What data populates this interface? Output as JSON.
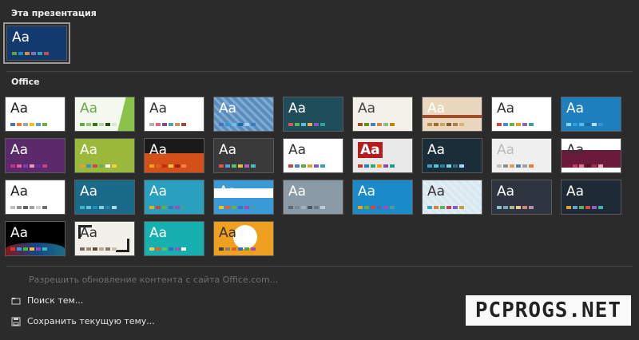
{
  "sections": {
    "this_presentation": "Эта презентация",
    "office": "Office"
  },
  "menu": {
    "allow_update": "Разрешить обновление контента с сайта Office.com...",
    "browse": "Поиск тем...",
    "save": "Сохранить текущую тему..."
  },
  "watermark": "PCPROGS.NET",
  "current_theme": {
    "bg": "#123a6e",
    "text": "#ffffff",
    "label": "Aa",
    "swatches": [
      "#6a9a3a",
      "#1e88c8",
      "#e08a2a",
      "#8c6cc0",
      "#39a0b0",
      "#c05050"
    ]
  },
  "themes": [
    {
      "bg": "#ffffff",
      "text": "#222222",
      "label": "Aa",
      "swatches": [
        "#4472c4",
        "#ed7d31",
        "#a5a5a5",
        "#ffc000",
        "#5b9bd5",
        "#70ad47"
      ]
    },
    {
      "bg": "#f4f9ee",
      "text": "#6aa84f",
      "label": "Aa",
      "swatches": [
        "#6aa84f",
        "#93c47d",
        "#38761d",
        "#b6d7a8",
        "#274e13",
        "#d9ead3"
      ],
      "accent": "#8bc34a"
    },
    {
      "bg": "#ffffff",
      "text": "#333333",
      "label": "Aa",
      "swatches": [
        "#b5b5b5",
        "#d96c75",
        "#7a4e8c",
        "#4fa3b8",
        "#c29b4a",
        "#9b4a4a"
      ]
    },
    {
      "bg": "#5a8dbf",
      "text": "#ffffff",
      "label": "Aa",
      "swatches": [
        "#4472c4",
        "#2f9bd6",
        "#6fc0e0",
        "#1f6aa5",
        "#9ad0ec",
        "#3a7bbf"
      ],
      "pattern": true
    },
    {
      "bg": "#1f4e5a",
      "text": "#ffffff",
      "label": "Aa",
      "swatches": [
        "#d9534f",
        "#5cb85c",
        "#5bc0de",
        "#f0ad4e",
        "#7e57c2",
        "#26a69a"
      ]
    },
    {
      "bg": "#f3f1ea",
      "text": "#444444",
      "label": "Aa",
      "swatches": [
        "#a0522d",
        "#6b8e23",
        "#4682b4",
        "#cd853f",
        "#8fbc8f",
        "#b8860b"
      ]
    },
    {
      "bg": "#e9d8bf",
      "text": "#ffffff",
      "label": "Aa",
      "swatches": [
        "#c48a3a",
        "#9e6b2a",
        "#d4a35a",
        "#8a5a2a",
        "#b07d40",
        "#e0b070"
      ],
      "bar": "#a24c2a"
    },
    {
      "bg": "#ffffff",
      "text": "#333333",
      "label": "Aa",
      "swatches": [
        "#c84a4a",
        "#4a8ac8",
        "#6ab04c",
        "#e0a030",
        "#9060c0",
        "#40a0a0"
      ]
    },
    {
      "bg": "#1e7fbf",
      "text": "#ffffff",
      "label": "Aa",
      "swatches": [
        "#8fd0f0",
        "#2a9fd8",
        "#5ab8e8",
        "#1a6aa0",
        "#b0e0f8",
        "#3a90c8"
      ]
    },
    {
      "bg": "#5a2a6a",
      "text": "#ffffff",
      "label": "Aa",
      "swatches": [
        "#c03090",
        "#e060a0",
        "#8040b0",
        "#f090c0",
        "#6030a0",
        "#d04080"
      ]
    },
    {
      "bg": "#9ab83a",
      "text": "#ffffff",
      "label": "Aa",
      "swatches": [
        "#e8a030",
        "#4a8ac8",
        "#c84a4a",
        "#6ab04c",
        "#ffffff",
        "#f0d040"
      ]
    },
    {
      "bg": "#d4501a",
      "text": "#ffffff",
      "label": "Aa",
      "swatches": [
        "#f0a020",
        "#e06020",
        "#c03010",
        "#f0c040",
        "#a02010",
        "#ff8040"
      ],
      "dark_top": true
    },
    {
      "bg": "#3a3a3a",
      "text": "#ffffff",
      "label": "Aa",
      "swatches": [
        "#e05050",
        "#50a0e0",
        "#60c060",
        "#e0c040",
        "#b060d0",
        "#40c0c0"
      ]
    },
    {
      "bg": "#ffffff",
      "text": "#333333",
      "label": "Aa",
      "swatches": [
        "#d04040",
        "#4080d0",
        "#50b050",
        "#e0a030",
        "#9050c0",
        "#40a0a0"
      ]
    },
    {
      "bg": "#e8e8e8",
      "text": "#ffffff",
      "label": "Aa",
      "swatches": [
        "#c0392b",
        "#2980b9",
        "#27ae60",
        "#f39c12",
        "#8e44ad",
        "#16a085"
      ],
      "red_label": true
    },
    {
      "bg": "#1a2e3a",
      "text": "#ffffff",
      "label": "Aa",
      "swatches": [
        "#40a0c0",
        "#60c0e0",
        "#2080a0",
        "#80d0e8",
        "#307090",
        "#a0e0f0"
      ]
    },
    {
      "bg": "#f0f0f0",
      "text": "#bbbbbb",
      "label": "Aa",
      "swatches": [
        "#c0c0c0",
        "#909090",
        "#d0a060",
        "#6080a0",
        "#a0a0a0",
        "#e08040"
      ]
    },
    {
      "bg": "#ffffff",
      "text": "#333333",
      "label": "Aa",
      "swatches": [
        "#7a1a3a",
        "#c04060",
        "#e07090",
        "#501030",
        "#a03050",
        "#f0a0b0"
      ],
      "maroon_band": true
    },
    {
      "bg": "#ffffff",
      "text": "#222222",
      "label": "Aa",
      "swatches": [
        "#c0c0c0",
        "#909090",
        "#606060",
        "#a0a0a0",
        "#d0d0d0",
        "#707070"
      ]
    },
    {
      "bg": "#1a6a8a",
      "text": "#ffffff",
      "label": "Aa",
      "swatches": [
        "#40b0d0",
        "#60c0e0",
        "#2090b0",
        "#80d0e8",
        "#3080a0",
        "#a0e0f0"
      ]
    },
    {
      "bg": "#2aa0c0",
      "text": "#ffffff",
      "label": "Aa",
      "swatches": [
        "#e0b020",
        "#c05030",
        "#60b040",
        "#4070c0",
        "#a050b0",
        "#40a0a0"
      ]
    },
    {
      "bg": "#3a9ad8",
      "text": "#ffffff",
      "label": "Aa",
      "swatches": [
        "#f0c020",
        "#e06030",
        "#70b040",
        "#4070c0",
        "#a050b0",
        "#40a0a0"
      ],
      "white_band": true
    },
    {
      "bg": "#8a9aa6",
      "text": "#ffffff",
      "label": "Aa",
      "swatches": [
        "#5a6a78",
        "#7a8a98",
        "#a0b0bc",
        "#4a5a66",
        "#6a7a88",
        "#c0ccd4"
      ]
    },
    {
      "bg": "#1a8ac8",
      "text": "#ffffff",
      "label": "Aa",
      "swatches": [
        "#f0a020",
        "#60b040",
        "#e04040",
        "#4070c0",
        "#a050b0",
        "#40a0a0"
      ]
    },
    {
      "bg": "#d8e8f0",
      "text": "#333333",
      "label": "Aa",
      "swatches": [
        "#40a0c0",
        "#e08040",
        "#60b060",
        "#c04060",
        "#8060c0",
        "#c0a040"
      ],
      "pattern": true
    },
    {
      "bg": "#2e3440",
      "text": "#ffffff",
      "label": "Aa",
      "swatches": [
        "#88c0d0",
        "#81a1c1",
        "#a3be8c",
        "#ebcb8b",
        "#d08770",
        "#b48ead"
      ]
    },
    {
      "bg": "#1e2a36",
      "text": "#ffffff",
      "label": "Aa",
      "swatches": [
        "#e0a030",
        "#60a0d0",
        "#60b060",
        "#d05050",
        "#9060c0",
        "#40b0b0"
      ]
    },
    {
      "bg": "#000000",
      "text": "#ffffff",
      "label": "Aa",
      "swatches": [
        "#e03030",
        "#30a0e0",
        "#40c040",
        "#f0c030",
        "#a040c0",
        "#30c0c0"
      ],
      "wave": true
    },
    {
      "bg": "#f2f0ea",
      "text": "#333333",
      "label": "Aa",
      "swatches": [
        "#7a6a5a",
        "#a08a70",
        "#5a4a3a",
        "#c0a888",
        "#8a7a6a",
        "#d0c0a8"
      ],
      "bracket": true
    },
    {
      "bg": "#17b0b0",
      "text": "#ffffff",
      "label": "Aa",
      "swatches": [
        "#f0d040",
        "#e06030",
        "#60c060",
        "#3070c0",
        "#a050b0",
        "#ffffff"
      ]
    },
    {
      "bg": "#f0a020",
      "text": "#333333",
      "label": "Aa",
      "swatches": [
        "#404040",
        "#808080",
        "#e06020",
        "#3070c0",
        "#60a040",
        "#a050b0"
      ],
      "circle": true
    }
  ]
}
